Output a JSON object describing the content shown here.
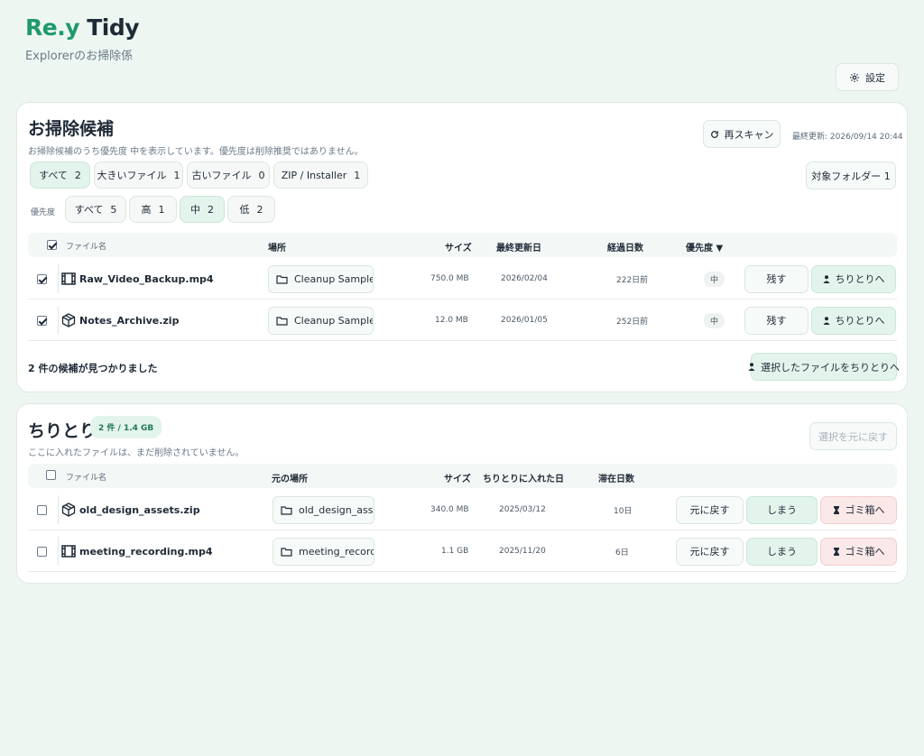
{
  "app": {
    "brand_accent": "Re.y",
    "brand_rest": " Tidy",
    "subtitle": "Explorerのお掃除係",
    "settings_label": "設定"
  },
  "colors": {
    "accent": "#1f9a6b",
    "background": "#eef6f2",
    "danger_bg": "#fbe8e8",
    "success_bg": "#e3f4ec"
  },
  "cleanup": {
    "title": "お掃除候補",
    "description": "お掃除候補のうち優先度 中を表示しています。優先度は削除推奨ではありません。",
    "rescan_label": "再スキャン",
    "last_updated": "最終更新: 2026/09/14 20:44",
    "target_folder_label": "対象フォルダー  1",
    "type_filters": [
      {
        "label": "すべて",
        "count": "2"
      },
      {
        "label": "大きいファイル",
        "count": "1"
      },
      {
        "label": "古いファイル",
        "count": "0"
      },
      {
        "label": "ZIP / Installer",
        "count": "1"
      }
    ],
    "priority_label": "優先度",
    "priority_filters": [
      {
        "label": "すべて",
        "count": "5"
      },
      {
        "label": "高",
        "count": "1"
      },
      {
        "label": "中",
        "count": "2"
      },
      {
        "label": "低",
        "count": "2"
      }
    ],
    "columns": {
      "name": "ファイル名",
      "location": "場所",
      "size": "サイズ",
      "modified": "最終更新日",
      "elapsed": "経過日数",
      "priority": "優先度 ▼"
    },
    "rows": [
      {
        "name": "Raw_Video_Backup.mp4",
        "icon": "film-icon",
        "location": "Cleanup Samples",
        "size": "750.0 MB",
        "modified": "2026/02/04",
        "elapsed": "222日前",
        "priority": "中",
        "keep": "残す",
        "move": "ちりとりへ"
      },
      {
        "name": "Notes_Archive.zip",
        "icon": "package-icon",
        "location": "Cleanup Samples",
        "size": "12.0 MB",
        "modified": "2026/01/05",
        "elapsed": "252日前",
        "priority": "中",
        "keep": "残す",
        "move": "ちりとりへ"
      }
    ],
    "found_text": "2 件の候補が見つかりました",
    "move_selected_label": "選択したファイルをちりとりへ"
  },
  "dustpan": {
    "title": "ちりとり",
    "badge": "2 件 / 1.4 GB",
    "description": "ここに入れたファイルは、まだ削除されていません。",
    "restore_selected_label": "選択を元に戻す",
    "columns": {
      "name": "ファイル名",
      "origin": "元の場所",
      "size": "サイズ",
      "added": "ちりとりに入れた日",
      "stay": "滞在日数"
    },
    "rows": [
      {
        "name": "old_design_assets.zip",
        "icon": "package-icon",
        "origin": "old_design_assets",
        "size": "340.0 MB",
        "added": "2025/03/12",
        "stay": "10日",
        "restore": "元に戻す",
        "store": "しまう",
        "trash": "ゴミ箱へ"
      },
      {
        "name": "meeting_recording.mp4",
        "icon": "film-icon",
        "origin": "meeting_recording",
        "size": "1.1 GB",
        "added": "2025/11/20",
        "stay": "6日",
        "restore": "元に戻す",
        "store": "しまう",
        "trash": "ゴミ箱へ"
      }
    ]
  }
}
